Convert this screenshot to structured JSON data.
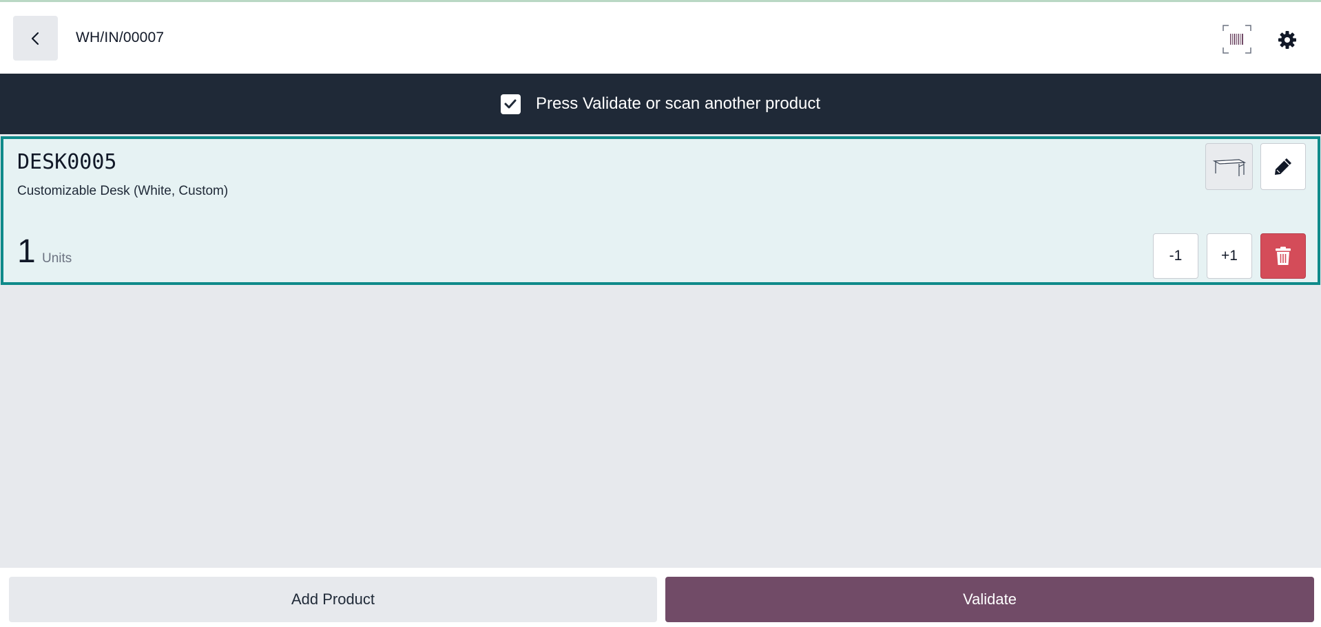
{
  "header": {
    "title": "WH/IN/00007",
    "back_icon": "chevron-left-icon",
    "scan_icon": "barcode-scan-icon",
    "settings_icon": "gear-icon"
  },
  "banner": {
    "message": "Press Validate or scan another product",
    "icon": "checkbox-checked-icon"
  },
  "line": {
    "product_code": "DESK0005",
    "product_name": "Customizable Desk (White, Custom)",
    "quantity": "1",
    "unit": "Units",
    "minus_label": "-1",
    "plus_label": "+1",
    "image_icon": "desk-product-image",
    "edit_icon": "pencil-icon",
    "delete_icon": "trash-icon"
  },
  "footer": {
    "add_product_label": "Add Product",
    "validate_label": "Validate"
  },
  "colors": {
    "banner_bg": "#1f2937",
    "line_border": "#0f8a8a",
    "line_bg": "#e6f2f3",
    "validate_bg": "#714b67",
    "delete_bg": "#d44c59"
  }
}
